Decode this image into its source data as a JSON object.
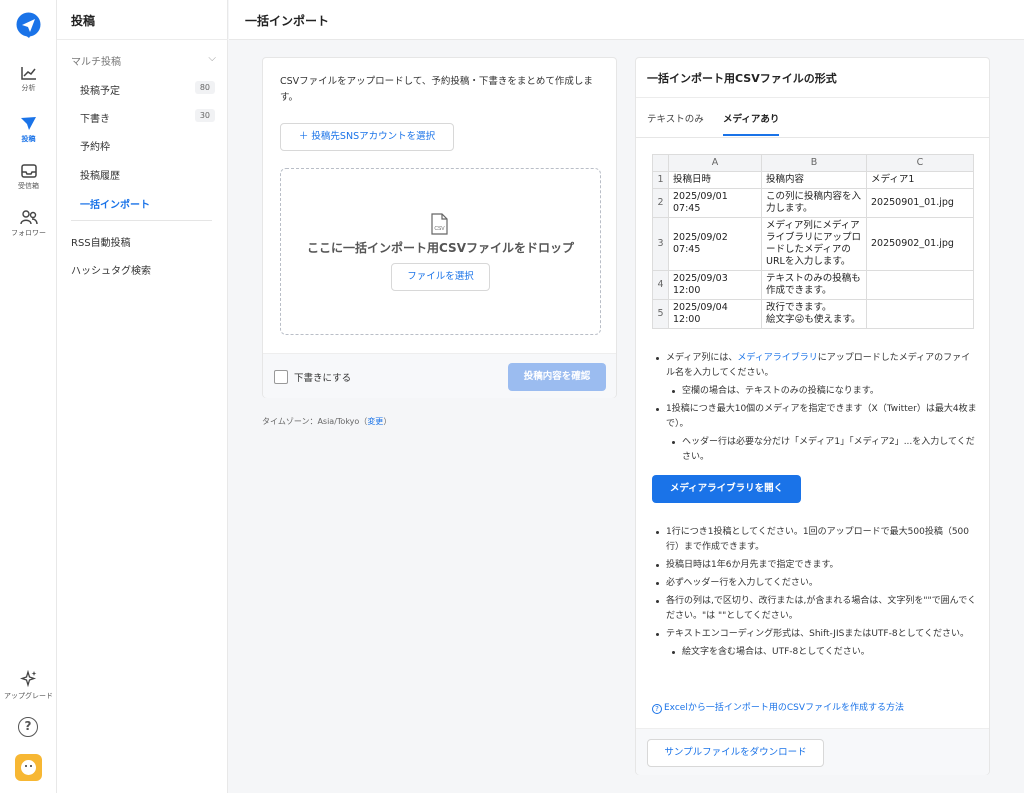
{
  "rail": {
    "items": [
      {
        "label": "分析",
        "icon": "chart-icon"
      },
      {
        "label": "投稿",
        "icon": "send-icon"
      },
      {
        "label": "受信箱",
        "icon": "inbox-icon"
      },
      {
        "label": "フォロワー",
        "icon": "followers-icon"
      }
    ],
    "upgrade_label": "アップグレード",
    "help_glyph": "?",
    "accent": "#1a73e8"
  },
  "subnav": {
    "title": "投稿",
    "group_label": "マルチ投稿",
    "items": [
      {
        "label": "投稿予定",
        "count": "80"
      },
      {
        "label": "下書き",
        "count": "30"
      },
      {
        "label": "予約枠"
      },
      {
        "label": "投稿履歴"
      },
      {
        "label": "一括インポート"
      }
    ],
    "bottom_items": [
      "RSS自動投稿",
      "ハッシュタグ検索"
    ]
  },
  "header": {
    "title": "一括インポート"
  },
  "upload": {
    "description": "CSVファイルをアップロードして、予約投稿・下書きをまとめて作成します。",
    "select_sns_label": "＋ 投稿先SNSアカウントを選択",
    "csv_icon_text": "CSV",
    "drop_text": "ここに一括インポート用CSVファイルをドロップ",
    "file_button": "ファイルを選択",
    "draft_checkbox_label": "下書きにする",
    "confirm_button": "投稿内容を確認",
    "timezone_prefix": "タイムゾーン：Asia/Tokyo（",
    "timezone_link": "変更",
    "timezone_suffix": "）"
  },
  "format": {
    "title": "一括インポート用CSVファイルの形式",
    "tabs": [
      "テキストのみ",
      "メディアあり"
    ],
    "active_tab": "メディアあり",
    "table": {
      "columns": [
        "A",
        "B",
        "C"
      ],
      "rows": [
        {
          "n": "1",
          "a": "投稿日時",
          "b": "投稿内容",
          "c": "メディア1"
        },
        {
          "n": "2",
          "a": "2025/09/01 07:45",
          "b": "この列に投稿内容を入力します。",
          "c": "20250901_01.jpg"
        },
        {
          "n": "3",
          "a": "2025/09/02 07:45",
          "b": "メディア列にメディアライブラリにアップロードしたメディアのURLを入力します。",
          "c": "20250902_01.jpg"
        },
        {
          "n": "4",
          "a": "2025/09/03 12:00",
          "b": "テキストのみの投稿も作成できます。",
          "c": ""
        },
        {
          "n": "5",
          "a": "2025/09/04 12:00",
          "b": "改行できます。",
          "b2": "絵文字😜も使えます。",
          "c": ""
        }
      ]
    },
    "notes_a": {
      "n1_pre": "メディア列には、",
      "n1_link": "メディアライブラリ",
      "n1_post": "にアップロードしたメディアのファイル名を入力してください。",
      "n1_sub": "空欄の場合は、テキストのみの投稿になります。",
      "n2": "1投稿につき最大10個のメディアを指定できます（X（Twitter）は最大4枚まで）。",
      "n2_sub": "ヘッダー行は必要な分だけ「メディア1」「メディア2」...を入力してください。"
    },
    "media_button": "メディアライブラリを開く",
    "notes_b": {
      "b1": "1行につき1投稿としてください。1回のアップロードで最大500投稿（500行）まで作成できます。",
      "b2": "投稿日時は1年6か月先まで指定できます。",
      "b3": "必ずヘッダー行を入力してください。",
      "b4": "各行の列は,で区切り、改行または,が含まれる場合は、文字列を\"\"で囲んでください。\"は \"\"としてください。",
      "b5": "テキストエンコーディング形式は、Shift-JISまたはUTF-8としてください。",
      "b5_sub": "絵文字を含む場合は、UTF-8としてください。"
    },
    "excel_link": "Excelから一括インポート用のCSVファイルを作成する方法",
    "sample_button": "サンプルファイルをダウンロード"
  }
}
